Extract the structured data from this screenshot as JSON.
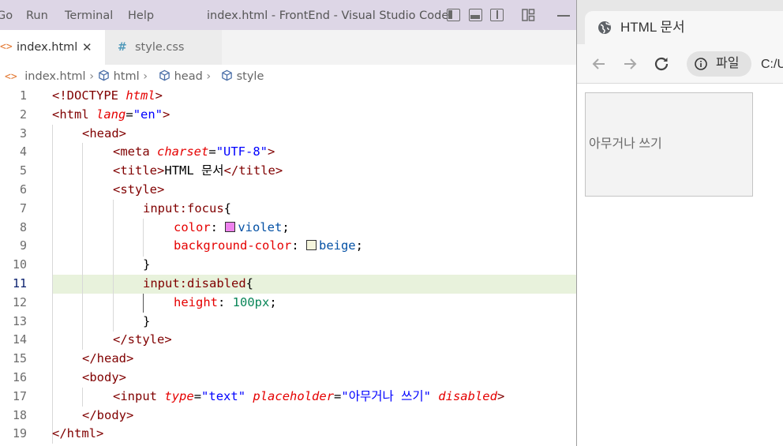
{
  "vscode": {
    "menu": [
      "Go",
      "Run",
      "Terminal",
      "Help"
    ],
    "window_title": "index.html - FrontEnd - Visual Studio Code",
    "tabs": [
      {
        "label": "index.html",
        "icon": "html-file-icon",
        "active": true,
        "close": "✕"
      },
      {
        "label": "style.css",
        "icon": "css-hash-icon",
        "active": false
      }
    ],
    "breadcrumb": [
      {
        "label": "index.html",
        "icon": "html-file-icon"
      },
      {
        "label": "html",
        "icon": "symbol-field-icon"
      },
      {
        "label": "head",
        "icon": "symbol-field-icon"
      },
      {
        "label": "style",
        "icon": "symbol-field-icon"
      }
    ],
    "current_line": 11,
    "swatch_colors": {
      "violet": "#ee82ee",
      "beige": "#f5f5dc"
    },
    "line_numbers": [
      "1",
      "2",
      "3",
      "4",
      "5",
      "6",
      "7",
      "8",
      "9",
      "10",
      "11",
      "12",
      "13",
      "14",
      "15",
      "16",
      "17",
      "18",
      "19"
    ],
    "code": {
      "l1": {
        "open": "<!",
        "kw": "DOCTYPE",
        "attr": "html",
        "close": ">"
      },
      "l2": {
        "open": "<",
        "tag": "html",
        "attr": "lang",
        "eq": "=",
        "val": "\"en\"",
        "close": ">"
      },
      "l3": {
        "open": "<",
        "tag": "head",
        "close": ">"
      },
      "l4": {
        "open": "<",
        "tag": "meta",
        "attr": "charset",
        "eq": "=",
        "val": "\"UTF-8\"",
        "close": ">"
      },
      "l5": {
        "open": "<",
        "tag": "title",
        "close": ">",
        "text": "HTML 문서",
        "endopen": "</",
        "endtag": "title",
        "endclose": ">"
      },
      "l6": {
        "open": "<",
        "tag": "style",
        "close": ">"
      },
      "l7": {
        "sel": "input:focus",
        "brace": "{"
      },
      "l8": {
        "prop": "color",
        "colon": ": ",
        "val": "violet",
        "semi": ";"
      },
      "l9": {
        "prop": "background-color",
        "colon": ": ",
        "val": "beige",
        "semi": ";"
      },
      "l10": {
        "brace": "}"
      },
      "l11": {
        "sel": "input:disabled",
        "brace": "{"
      },
      "l12": {
        "prop": "height",
        "colon": ": ",
        "val": "100px",
        "semi": ";"
      },
      "l13": {
        "brace": "}"
      },
      "l14": {
        "open": "</",
        "tag": "style",
        "close": ">"
      },
      "l15": {
        "open": "</",
        "tag": "head",
        "close": ">"
      },
      "l16": {
        "open": "<",
        "tag": "body",
        "close": ">"
      },
      "l17": {
        "open": "<",
        "tag": "input",
        "attr1": "type",
        "eq1": "=",
        "val1": "\"text\"",
        "attr2": "placeholder",
        "eq2": "=",
        "val2": "\"아무거나 쓰기\"",
        "attr3": "disabled",
        "close": ">"
      },
      "l18": {
        "open": "</",
        "tag": "body",
        "close": ">"
      },
      "l19": {
        "open": "</",
        "tag": "html",
        "close": ">"
      }
    }
  },
  "browser": {
    "tab_title": "HTML 문서",
    "site_info_label": "파일",
    "url": "C:/U",
    "input_placeholder": "아무거나 쓰기"
  }
}
